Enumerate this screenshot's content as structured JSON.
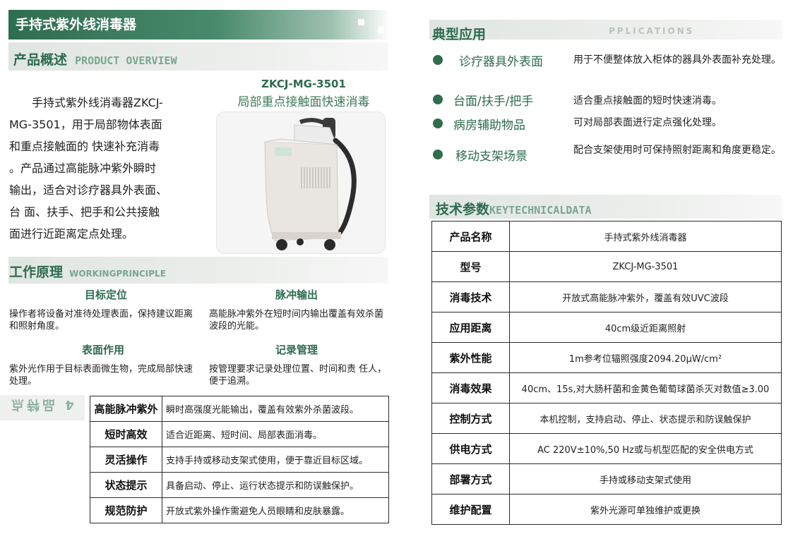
{
  "header": {
    "title": "手持式紫外线消毒器"
  },
  "overview": {
    "title": "产品概述",
    "title_en": "PRODUCT OVERVIEW",
    "lines": [
      "　　手持式紫外线消毒器ZKCJ-",
      "MG-3501，用于局部物体表面",
      "和重点接触面的 快速补充消毒",
      "。产品通过高能脉冲紫外瞬时",
      "输出，适合对诊疗器具外表面、",
      "台 面、扶手、把手和公共接触",
      "面进行近距离定点处理。"
    ],
    "model": "ZKCJ-MG-3501",
    "model_sub": "局部重点接触面快速消毒"
  },
  "principle": {
    "title": "工作原理",
    "title_en": "WORKINGPRINCIPLE",
    "items": [
      {
        "head": "目标定位",
        "text": "操作者将设备对准待处理表面，保持建议距离和照射角度。"
      },
      {
        "head": "脉冲输出",
        "text": "高能脉冲紫外在短时间内输出覆盖有效杀菌波段的光能。"
      },
      {
        "head": "表面作用",
        "text": "紫外光作用于目标表面微生物，完成局部快速处理。"
      },
      {
        "head": "记录管理",
        "text": "按管理要求记录处理位置、时间和责 任人，便于追溯。"
      }
    ]
  },
  "features": {
    "side_label": "4 品特点",
    "rows": [
      {
        "key": "高能脉冲紫外",
        "value": "瞬时高强度光能输出，覆盖有效紫外杀菌波段。"
      },
      {
        "key": "短时高效",
        "value": "适合近距离、短时间、局部表面消毒。"
      },
      {
        "key": "灵活操作",
        "value": "支持手持或移动支架式使用，便于靠近目标区域。"
      },
      {
        "key": "状态提示",
        "value": "具备启动、停止、运行状态提示和防误触保护。"
      },
      {
        "key": "规范防护",
        "value": "开放式紫外操作需避免人员眼睛和皮肤暴露。"
      }
    ]
  },
  "applications": {
    "title": "典型应用",
    "title_en": "PPLICATIONS",
    "items": [
      {
        "label": "诊疗器具外表面",
        "desc": "用于不便整体放入柜体的器具外表面补充处理。"
      },
      {
        "label": "台面/扶手/把手",
        "desc": "适合重点接触面的短时快速消毒。"
      },
      {
        "label": "病房辅助物品",
        "desc": "可对局部表面进行定点强化处理。"
      },
      {
        "label": "移动支架场景",
        "desc": "配合支架使用时可保持照射距离和角度更稳定。"
      }
    ]
  },
  "specs": {
    "title": "技术参数",
    "title_en": "KEYTECHNICALDATA",
    "rows": [
      {
        "key": "产品名称",
        "value": "手持式紫外线消毒器"
      },
      {
        "key": "型号",
        "value": "ZKCJ-MG-3501"
      },
      {
        "key": "消毒技术",
        "value": "开放式高能脉冲紫外，覆盖有效UVC波段"
      },
      {
        "key": "应用距离",
        "value": "40cm级近距离照射"
      },
      {
        "key": "紫外性能",
        "value": "1m参考位辐照强度2094.20μW/cm²"
      },
      {
        "key": "消毒效果",
        "value": "40cm、15s,对大肠杆菌和金黄色葡萄球菌杀灭对数值≥3.00"
      },
      {
        "key": "控制方式",
        "value": "本机控制，支持启动、停止、状态提示和防误触保护"
      },
      {
        "key": "供电方式",
        "value": "AC 220V±10%,50 Hz或与机型匹配的安全供电方式"
      },
      {
        "key": "部署方式",
        "value": "手持或移动支架式使用"
      },
      {
        "key": "维护配置",
        "value": "紫外光源可单独维护或更换"
      }
    ]
  }
}
